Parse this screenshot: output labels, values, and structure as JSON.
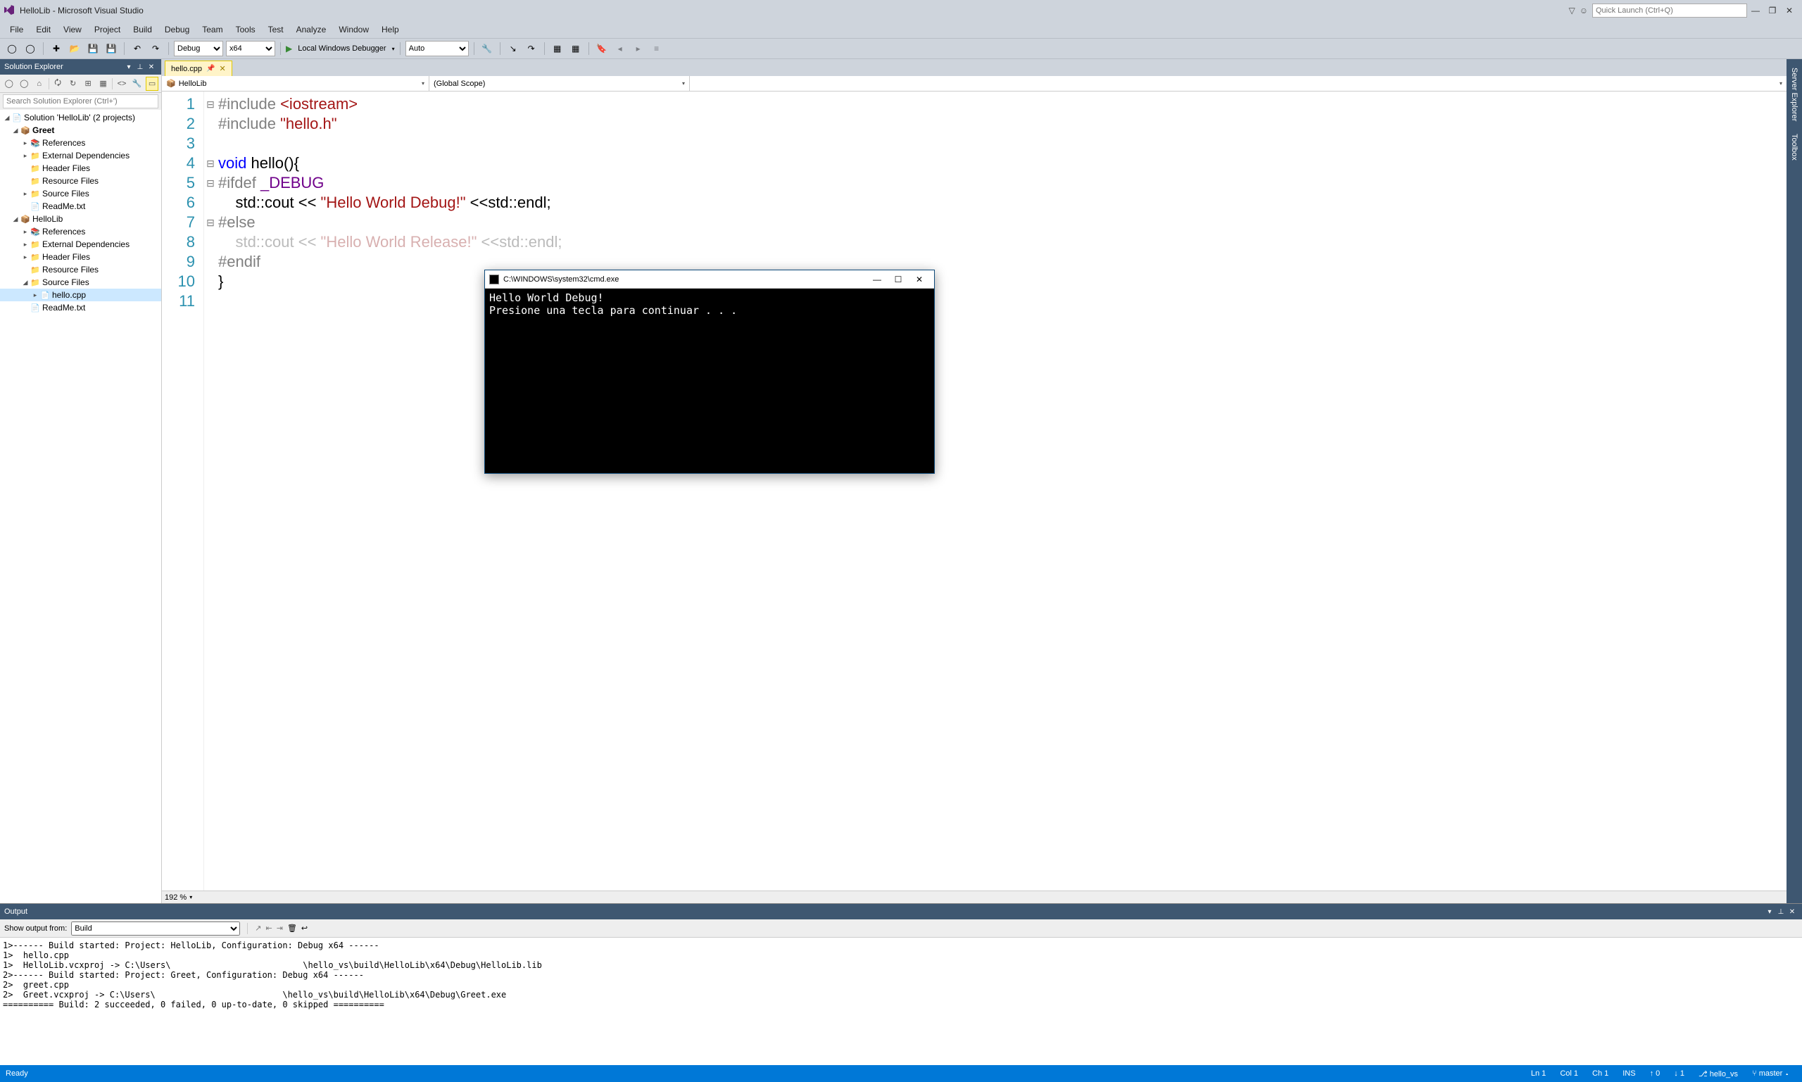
{
  "title": "HelloLib - Microsoft Visual Studio",
  "quick_launch_placeholder": "Quick Launch (Ctrl+Q)",
  "menu": [
    "File",
    "Edit",
    "View",
    "Project",
    "Build",
    "Debug",
    "Team",
    "Tools",
    "Test",
    "Analyze",
    "Window",
    "Help"
  ],
  "toolbar": {
    "config": "Debug",
    "platform": "x64",
    "debugger_label": "Local Windows Debugger",
    "auto": "Auto"
  },
  "solution_explorer": {
    "title": "Solution Explorer",
    "search_placeholder": "Search Solution Explorer (Ctrl+')",
    "tree": {
      "solution": "Solution 'HelloLib' (2 projects)",
      "projects": [
        {
          "name": "Greet",
          "bold": true,
          "children": [
            "References",
            "External Dependencies",
            "Header Files",
            "Resource Files",
            "Source Files",
            "ReadMe.txt"
          ]
        },
        {
          "name": "HelloLib",
          "bold": false,
          "children": [
            "References",
            "External Dependencies",
            "Header Files",
            "Resource Files",
            "Source Files",
            "ReadMe.txt"
          ],
          "source_files": [
            "hello.cpp"
          ]
        }
      ]
    }
  },
  "editor": {
    "tab": "hello.cpp",
    "nav_left": "HelloLib",
    "nav_mid": "(Global Scope)",
    "zoom": "192 %",
    "code_lines": [
      {
        "n": 1,
        "fold": "⊟",
        "html": "<span class='pp'>#include</span> <span class='str'>&lt;iostream&gt;</span>"
      },
      {
        "n": 2,
        "fold": "",
        "html": "<span class='pp'>#include</span> <span class='str'>\"hello.h\"</span>"
      },
      {
        "n": 3,
        "fold": "",
        "html": ""
      },
      {
        "n": 4,
        "fold": "⊟",
        "html": "<span class='kw'>void</span> hello(){"
      },
      {
        "n": 5,
        "fold": "⊟",
        "html": "<span class='pp'>#ifdef</span> <span style='color:#6f008a'>_DEBUG</span>"
      },
      {
        "n": 6,
        "fold": "",
        "html": "    std::cout &lt;&lt; <span class='str'>\"Hello World Debug!\"</span> &lt;&lt;std::endl;"
      },
      {
        "n": 7,
        "fold": "⊟",
        "html": "<span class='pp'>#else</span>"
      },
      {
        "n": 8,
        "fold": "",
        "html": "    <span class='dim'>std::cout &lt;&lt; </span><span class='dim-str'>\"Hello World Release!\"</span><span class='dim'> &lt;&lt;std::endl;</span>"
      },
      {
        "n": 9,
        "fold": "",
        "html": "<span class='pp'>#endif</span>"
      },
      {
        "n": 10,
        "fold": "",
        "html": "}"
      },
      {
        "n": 11,
        "fold": "",
        "html": ""
      }
    ]
  },
  "right_tabs": [
    "Server Explorer",
    "Toolbox"
  ],
  "output": {
    "title": "Output",
    "show_from_label": "Show output from:",
    "show_from_value": "Build",
    "text": "1>------ Build started: Project: HelloLib, Configuration: Debug x64 ------\n1>  hello.cpp\n1>  HelloLib.vcxproj -> C:\\Users\\                          \\hello_vs\\build\\HelloLib\\x64\\Debug\\HelloLib.lib\n2>------ Build started: Project: Greet, Configuration: Debug x64 ------\n2>  greet.cpp\n2>  Greet.vcxproj -> C:\\Users\\                         \\hello_vs\\build\\HelloLib\\x64\\Debug\\Greet.exe\n========== Build: 2 succeeded, 0 failed, 0 up-to-date, 0 skipped =========="
  },
  "statusbar": {
    "ready": "Ready",
    "ln": "Ln 1",
    "col": "Col 1",
    "ch": "Ch 1",
    "ins": "INS",
    "up": "↑ 0",
    "down": "↓ 1",
    "repo": "hello_vs",
    "branch": "master"
  },
  "console": {
    "title": "C:\\WINDOWS\\system32\\cmd.exe",
    "body": "Hello World Debug!\nPresione una tecla para continuar . . ."
  }
}
